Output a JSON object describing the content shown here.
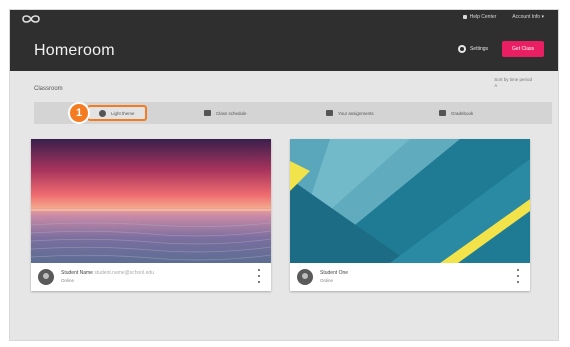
{
  "header": {
    "title": "Homeroom",
    "top_links": [
      "Help Center",
      "Account Info ▾"
    ],
    "settings_label": "Settings",
    "cta_label": "Get Class"
  },
  "section_label": "Classroom",
  "sort": {
    "label": "Sort by time period",
    "value": "A"
  },
  "step_badge": "1",
  "tabs": [
    {
      "label": "Light theme",
      "icon": "brightness-icon"
    },
    {
      "label": "Class schedule",
      "icon": "calendar-icon"
    },
    {
      "label": "Your assignments",
      "icon": "assignment-icon"
    },
    {
      "label": "Gradebook",
      "icon": "gradebook-icon"
    }
  ],
  "cards": [
    {
      "name": "Student Name",
      "name_detail": "student.name@school.edu",
      "sub": "Online"
    },
    {
      "name": "Student One",
      "name_detail": "",
      "sub": "Online"
    }
  ],
  "colors": {
    "header_bg": "#2f2f2f",
    "accent_pink": "#e91e63",
    "callout_orange": "#f47b20",
    "wallpaper_teal": "#1e7f9b",
    "wallpaper_yellow": "#f2e34b"
  }
}
